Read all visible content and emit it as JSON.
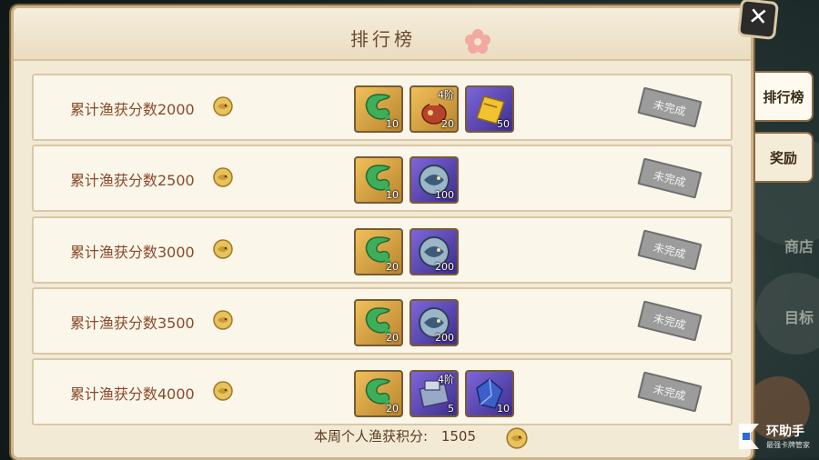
{
  "header": {
    "title": "排行榜"
  },
  "tabs": [
    {
      "label": "排行榜",
      "active": true
    },
    {
      "label": "奖励",
      "active": false
    }
  ],
  "background_labels": [
    "商店",
    "目标"
  ],
  "rewards": [
    {
      "label": "累计渔获分数2000",
      "status": "未完成",
      "items": [
        {
          "icon": "green-jade-icon",
          "color": "gold",
          "qty": "10",
          "tier": ""
        },
        {
          "icon": "potion-pot-icon",
          "color": "gold",
          "qty": "20",
          "tier": "4阶"
        },
        {
          "icon": "yellow-ticket-icon",
          "color": "purple",
          "qty": "50",
          "tier": ""
        }
      ]
    },
    {
      "label": "累计渔获分数2500",
      "status": "未完成",
      "items": [
        {
          "icon": "green-jade-icon",
          "color": "gold",
          "qty": "10",
          "tier": ""
        },
        {
          "icon": "fish-medal-icon",
          "color": "purple",
          "qty": "100",
          "tier": ""
        }
      ]
    },
    {
      "label": "累计渔获分数3000",
      "status": "未完成",
      "items": [
        {
          "icon": "green-jade-icon",
          "color": "gold",
          "qty": "20",
          "tier": ""
        },
        {
          "icon": "fish-medal-icon",
          "color": "purple",
          "qty": "200",
          "tier": ""
        }
      ]
    },
    {
      "label": "累计渔获分数3500",
      "status": "未完成",
      "items": [
        {
          "icon": "green-jade-icon",
          "color": "gold",
          "qty": "20",
          "tier": ""
        },
        {
          "icon": "fish-medal-icon",
          "color": "purple",
          "qty": "200",
          "tier": ""
        }
      ]
    },
    {
      "label": "累计渔获分数4000",
      "status": "未完成",
      "items": [
        {
          "icon": "green-jade-icon",
          "color": "gold",
          "qty": "20",
          "tier": ""
        },
        {
          "icon": "equipment-box-icon",
          "color": "purple",
          "qty": "5",
          "tier": "4阶"
        },
        {
          "icon": "blue-crystal-icon",
          "color": "purple",
          "qty": "10",
          "tier": ""
        }
      ]
    }
  ],
  "footer": {
    "text": "本周个人渔获积分:",
    "score": "1505"
  },
  "watermark": {
    "title": "环助手",
    "subtitle": "最强卡牌管家"
  },
  "colors": {
    "panel_bg": "#f3ead6",
    "label_text": "#8a4a2a",
    "gold_slot": "#f0c05a",
    "purple_slot": "#7d66d9"
  }
}
